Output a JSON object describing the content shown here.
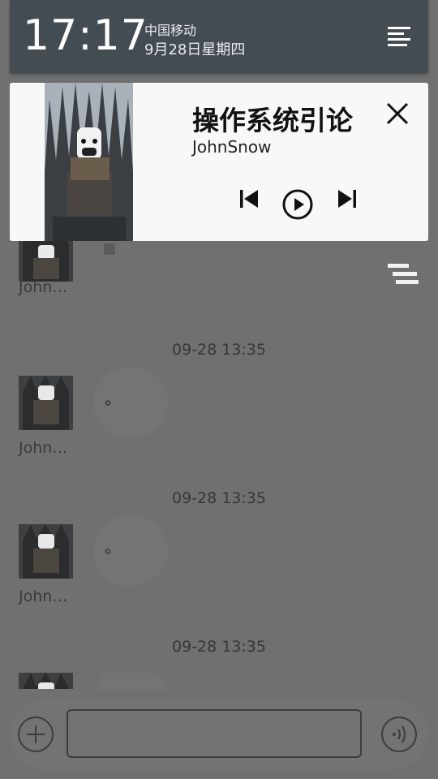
{
  "status": {
    "time": "17:17",
    "carrier": "中国移动",
    "date": "9月28日星期四"
  },
  "music": {
    "title": "操作系统引论",
    "artist": "JohnSnow",
    "controls": {
      "prev": "previous",
      "play": "play",
      "next": "next"
    }
  },
  "chat": {
    "messages": [
      {
        "sender": "John…",
        "text": ""
      },
      {
        "timestamp": "09-28 13:35",
        "sender": "John…",
        "text": "。"
      },
      {
        "timestamp": "09-28 13:35",
        "sender": "John…",
        "text": "。"
      },
      {
        "timestamp": "09-28 13:35",
        "sender": "",
        "text": ""
      }
    ]
  },
  "colors": {
    "status_bg": "#434b53",
    "card_bg": "#f8f8f8",
    "dim_bg": "#707070"
  }
}
